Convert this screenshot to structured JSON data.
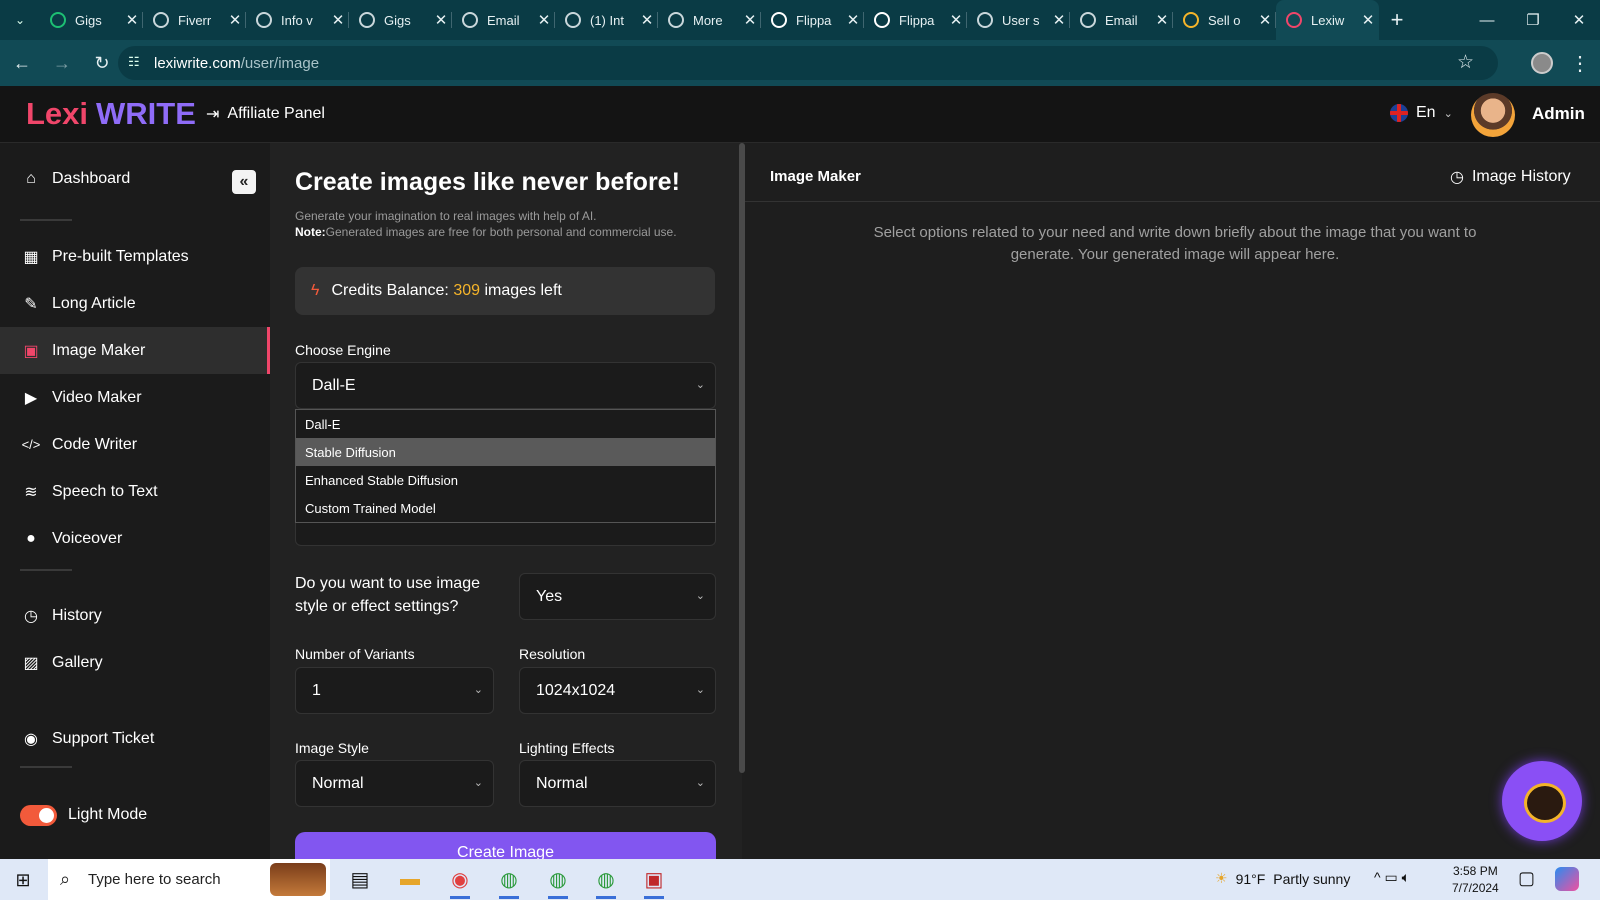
{
  "browser": {
    "tabs": [
      {
        "label": "Gigs",
        "favicon": "fiverr-icon",
        "color": "#1dbf73"
      },
      {
        "label": "Fiverr",
        "favicon": "globe-icon",
        "color": "#c9d7db"
      },
      {
        "label": "Info v",
        "favicon": "globe-icon",
        "color": "#c9d7db"
      },
      {
        "label": "Gigs",
        "favicon": "globe-icon",
        "color": "#c9d7db"
      },
      {
        "label": "Email",
        "favicon": "globe-icon",
        "color": "#c9d7db"
      },
      {
        "label": "(1) Int",
        "favicon": "globe-icon",
        "color": "#c9d7db"
      },
      {
        "label": "More",
        "favicon": "globe-icon",
        "color": "#c9d7db"
      },
      {
        "label": "Flippa",
        "favicon": "flippa-icon",
        "color": "#ffffff"
      },
      {
        "label": "Flippa",
        "favicon": "flippa-icon",
        "color": "#ffffff"
      },
      {
        "label": "User s",
        "favicon": "loading-icon",
        "color": "#c9d7db"
      },
      {
        "label": "Email",
        "favicon": "globe-icon",
        "color": "#c9d7db"
      },
      {
        "label": "Sell o",
        "favicon": "shop-icon",
        "color": "#f5b42a"
      },
      {
        "label": "Lexiw",
        "favicon": "lexiwrite-icon",
        "color": "#f0466a",
        "active": true
      }
    ],
    "url_host": "lexiwrite.com",
    "url_path": "/user/image"
  },
  "header": {
    "logo_part1": "Lexi",
    "logo_part2": "WRITE",
    "affiliate_label": "Affiliate Panel",
    "language": "En",
    "user_name": "Admin"
  },
  "sidebar": {
    "items": [
      {
        "label": "Dashboard",
        "icon": "home-icon"
      },
      {
        "label": "Pre-built Templates",
        "icon": "grid-icon"
      },
      {
        "label": "Long Article",
        "icon": "pen-icon"
      },
      {
        "label": "Image Maker",
        "icon": "image-icon",
        "active": true
      },
      {
        "label": "Video Maker",
        "icon": "video-icon"
      },
      {
        "label": "Code Writer",
        "icon": "code-icon"
      },
      {
        "label": "Speech to Text",
        "icon": "waveform-icon"
      },
      {
        "label": "Voiceover",
        "icon": "microphone-icon"
      },
      {
        "label": "History",
        "icon": "history-icon"
      },
      {
        "label": "Gallery",
        "icon": "gallery-icon"
      },
      {
        "label": "Support Ticket",
        "icon": "support-icon"
      }
    ],
    "light_mode_label": "Light Mode",
    "accent_color": "#f0466a"
  },
  "form": {
    "title": "Create images like never before!",
    "subtitle": "Generate your imagination to real images with help of AI.",
    "note_label": "Note:",
    "note_text": "Generated images are free for both personal and commercial use.",
    "credits_prefix": "Credits Balance: ",
    "credits_value": "309",
    "credits_suffix": " images left",
    "engine_label": "Choose Engine",
    "engine_value": "Dall-E",
    "engine_options": [
      "Dall-E",
      "Stable Diffusion",
      "Enhanced Stable Diffusion",
      "Custom Trained Model"
    ],
    "style_question": "Do you want to use image style or effect settings?",
    "style_answer": "Yes",
    "variants_label": "Number of Variants",
    "variants_value": "1",
    "resolution_label": "Resolution",
    "resolution_value": "1024x1024",
    "image_style_label": "Image Style",
    "image_style_value": "Normal",
    "lighting_label": "Lighting Effects",
    "lighting_value": "Normal",
    "create_button": "Create Image",
    "button_color": "#8256f0"
  },
  "result": {
    "title": "Image Maker",
    "history_label": "Image History",
    "message": "Select options related to your need and write down briefly about the image that you want to generate. Your generated image will appear here."
  },
  "taskbar": {
    "search_placeholder": "Type here to search",
    "weather_temp": "91°F",
    "weather_desc": "Partly sunny",
    "time": "3:58 PM",
    "date": "7/7/2024"
  }
}
